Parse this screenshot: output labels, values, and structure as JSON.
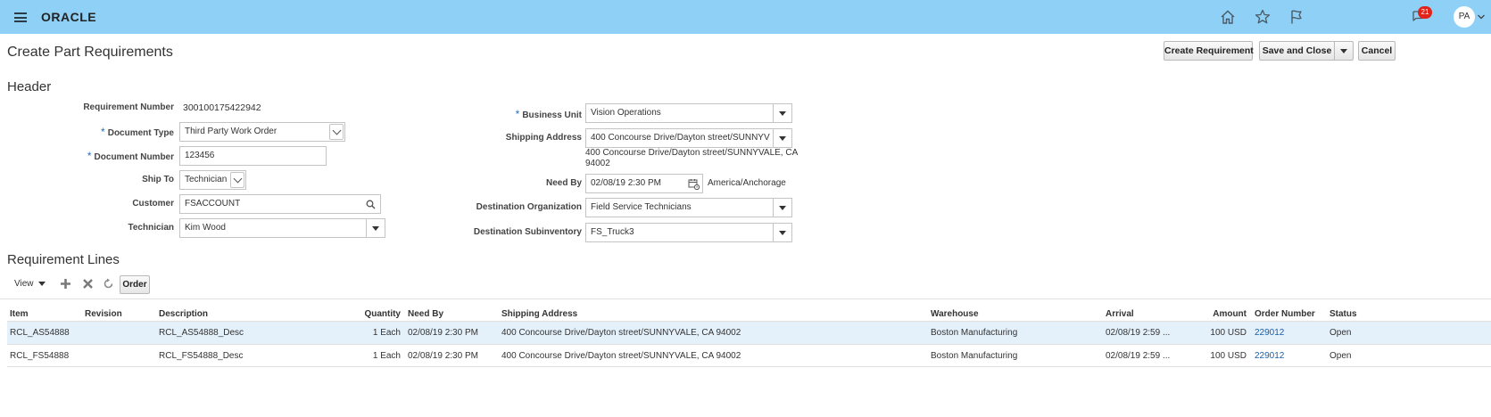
{
  "app": {
    "logo": "ORACLE",
    "notification_count": "21",
    "user_initials": "PA",
    "icons": [
      "menu-icon",
      "home-icon",
      "star-icon",
      "flag-icon",
      "notifications-icon",
      "chevron-down-icon"
    ],
    "colors": {
      "topbar": "#8fd0f6",
      "link": "#1a5fa8",
      "badge": "#e2231a",
      "required": "#2a6fb8"
    }
  },
  "page": {
    "title": "Create Part Requirements",
    "buttons": {
      "create_requirement": "Create Requirement",
      "save_and_close": "Save and Close",
      "cancel": "Cancel"
    }
  },
  "header": {
    "title": "Header",
    "requirement_number": {
      "label": "Requirement Number",
      "value": "300100175422942"
    },
    "document_type": {
      "label": "Document Type",
      "value": "Third Party Work Order"
    },
    "document_number": {
      "label": "Document Number",
      "value": "123456"
    },
    "ship_to": {
      "label": "Ship To",
      "value": "Technician"
    },
    "customer": {
      "label": "Customer",
      "value": "FSACCOUNT"
    },
    "technician": {
      "label": "Technician",
      "value": "Kim Wood"
    },
    "business_unit": {
      "label": "Business Unit",
      "value": "Vision Operations"
    },
    "shipping_address": {
      "label": "Shipping Address",
      "value": "400 Concourse Drive/Dayton street/SUNNYV",
      "full_line1": "400 Concourse Drive/Dayton street/SUNNYVALE, CA",
      "full_line2": "94002"
    },
    "need_by": {
      "label": "Need By",
      "value": "02/08/19 2:30 PM",
      "timezone": "America/Anchorage"
    },
    "destination_organization": {
      "label": "Destination Organization",
      "value": "Field Service Technicians"
    },
    "destination_subinventory": {
      "label": "Destination Subinventory",
      "value": "FS_Truck3"
    }
  },
  "requirement_lines": {
    "title": "Requirement Lines",
    "toolbar": {
      "view_label": "View",
      "order_label": "Order"
    },
    "columns": {
      "item": "Item",
      "revision": "Revision",
      "description": "Description",
      "quantity": "Quantity",
      "need_by": "Need By",
      "shipping_address": "Shipping Address",
      "warehouse": "Warehouse",
      "arrival": "Arrival",
      "amount": "Amount",
      "order_number": "Order Number",
      "status": "Status"
    },
    "rows": [
      {
        "item": "RCL_AS54888",
        "revision": "",
        "description": "RCL_AS54888_Desc",
        "quantity": "1 Each",
        "need_by": "02/08/19 2:30 PM",
        "shipping_address": "400 Concourse Drive/Dayton street/SUNNYVALE, CA 94002",
        "warehouse": "Boston Manufacturing",
        "arrival": "02/08/19 2:59 ...",
        "amount": "100 USD",
        "order_number": "229012",
        "status": "Open",
        "selected": true
      },
      {
        "item": "RCL_FS54888",
        "revision": "",
        "description": "RCL_FS54888_Desc",
        "quantity": "1 Each",
        "need_by": "02/08/19 2:30 PM",
        "shipping_address": "400 Concourse Drive/Dayton street/SUNNYVALE, CA 94002",
        "warehouse": "Boston Manufacturing",
        "arrival": "02/08/19 2:59 ...",
        "amount": "100 USD",
        "order_number": "229012",
        "status": "Open",
        "selected": false
      }
    ]
  }
}
